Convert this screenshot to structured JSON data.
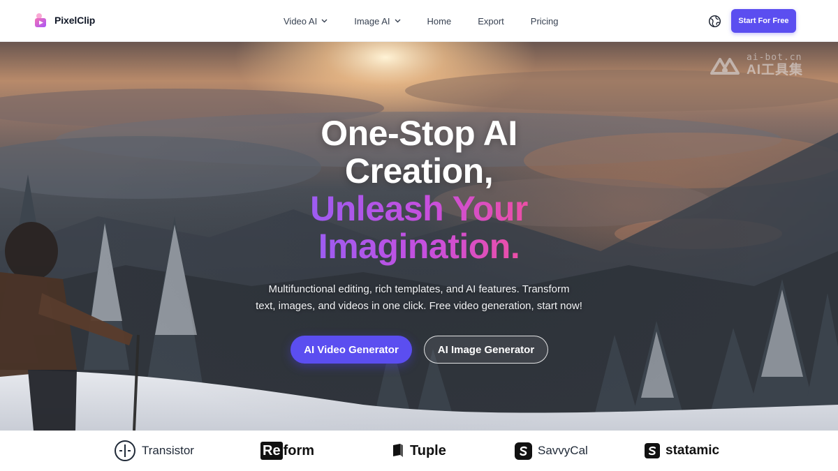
{
  "brand": {
    "name": "PixelClip",
    "logo_icon": "pixelclip-logo-icon"
  },
  "nav": {
    "items": [
      {
        "label": "Video AI",
        "has_dropdown": true
      },
      {
        "label": "Image AI",
        "has_dropdown": true
      },
      {
        "label": "Home",
        "has_dropdown": false
      },
      {
        "label": "Export",
        "has_dropdown": false
      },
      {
        "label": "Pricing",
        "has_dropdown": false
      }
    ],
    "language_icon": "globe-icon",
    "cta_label": "Start For Free"
  },
  "hero": {
    "headline_line1": "One-Stop AI",
    "headline_line2": "Creation,",
    "headline_line3": "Unleash Your",
    "headline_line4": "Imagination.",
    "subtitle_line1": "Multifunctional editing, rich templates, and AI features. Transform",
    "subtitle_line2": "text, images, and videos in one click. Free video generation, start now!",
    "primary_button": "AI Video Generator",
    "secondary_button": "AI Image Generator",
    "background": "snowy-mountain-sunset-image"
  },
  "watermark": {
    "line1": "ai-bot.cn",
    "line2": "AI工具集"
  },
  "partner_logos": [
    {
      "name": "Transistor",
      "icon": "transistor-icon"
    },
    {
      "name_box": "Re",
      "name_rest": "form",
      "icon": "reform-logo"
    },
    {
      "name": "Tuple",
      "icon": "tuple-icon"
    },
    {
      "name": "SavvyCal",
      "icon": "savvycal-icon"
    },
    {
      "name": "statamic",
      "icon": "statamic-icon"
    }
  ],
  "colors": {
    "accent": "#5b4ef0",
    "gradient_start": "#9d5cf1",
    "gradient_end": "#ec4fa6",
    "text_dark": "#1f2937"
  }
}
